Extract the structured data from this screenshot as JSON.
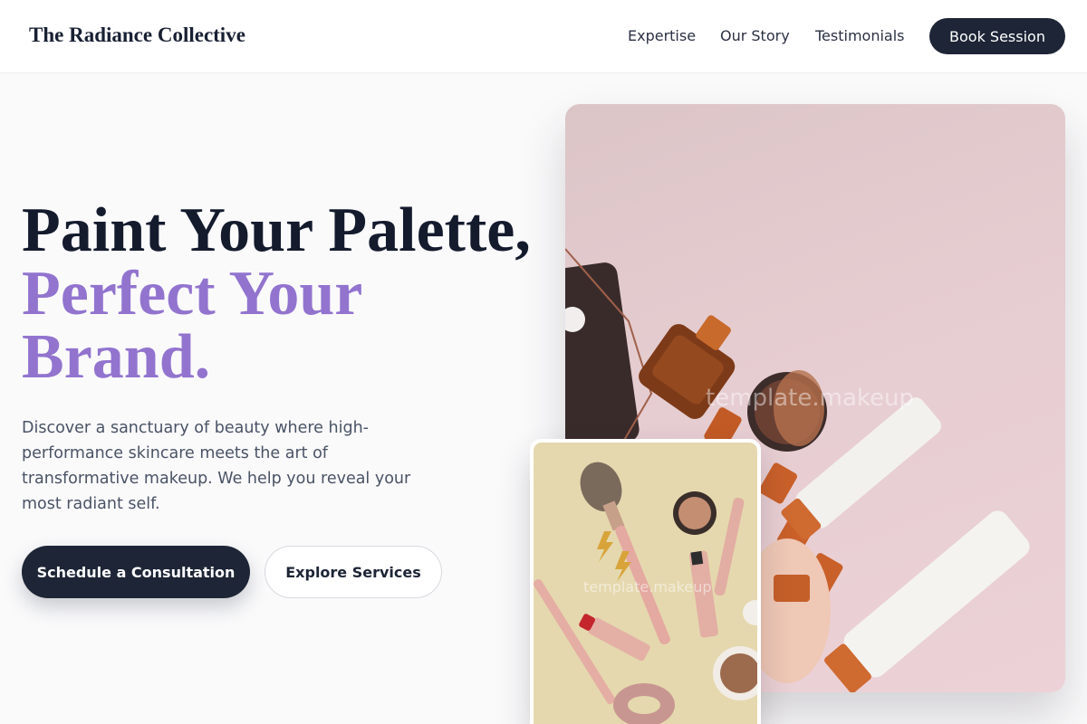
{
  "header": {
    "brand": "The Radiance Collective",
    "nav": [
      "Expertise",
      "Our Story",
      "Testimonials"
    ],
    "cta": "Book Session"
  },
  "hero": {
    "headline_line1": "Paint Your Palette,",
    "headline_line2": "Perfect Your",
    "headline_line3": "Brand.",
    "description": "Discover a sanctuary of beauty where high-performance skincare meets the art of transformative makeup. We help you reveal your most radiant self.",
    "primary_cta": "Schedule a Consultation",
    "secondary_cta": "Explore Services"
  },
  "images": {
    "main_watermark": "template.makeup",
    "inset_watermark": "template.makeup"
  },
  "colors": {
    "navy": "#1d2536",
    "accent_purple": "#9274cf",
    "background": "#fafafb"
  }
}
